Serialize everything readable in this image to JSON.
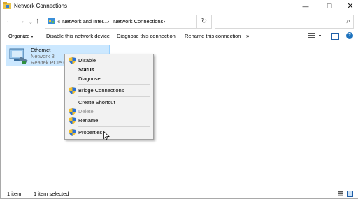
{
  "window": {
    "title": "Network Connections",
    "controls": {
      "minimize": "—",
      "maximize": "☐",
      "close": "✕"
    }
  },
  "navigation": {
    "back": "←",
    "forward": "→",
    "recent": "⌄",
    "up": "↑",
    "address_overflow": "«",
    "address_parts": [
      "Network and Inter...",
      "Network Connections"
    ],
    "address_separator": "›",
    "refresh": "↻",
    "search_placeholder": "",
    "search_icon": "⌕"
  },
  "toolbar": {
    "organize": "Organize",
    "organize_arrow": "▾",
    "disable": "Disable this network device",
    "diagnose": "Diagnose this connection",
    "rename": "Rename this connection",
    "more": "»",
    "view_arrow": "▾",
    "help": "?"
  },
  "content": {
    "items": [
      {
        "name": "Ethernet",
        "network": "Network 3",
        "adapter": "Realtek PCIe Gb",
        "selected": true
      }
    ]
  },
  "context_menu": {
    "items": [
      {
        "label": "Disable",
        "icon": "shield-icon",
        "bold": false,
        "disabled": false
      },
      {
        "label": "Status",
        "icon": "",
        "bold": true,
        "disabled": false
      },
      {
        "label": "Diagnose",
        "icon": "",
        "bold": false,
        "disabled": false
      },
      {
        "label": "Bridge Connections",
        "icon": "shield-icon",
        "bold": false,
        "disabled": false
      },
      {
        "label": "Create Shortcut",
        "icon": "",
        "bold": false,
        "disabled": false
      },
      {
        "label": "Delete",
        "icon": "shield-icon",
        "bold": false,
        "disabled": true
      },
      {
        "label": "Rename",
        "icon": "shield-icon",
        "bold": false,
        "disabled": false
      },
      {
        "label": "Properties",
        "icon": "shield-icon",
        "bold": false,
        "disabled": false
      }
    ]
  },
  "status_bar": {
    "item_count": "1 item",
    "selection": "1 item selected"
  },
  "colors": {
    "selection_fill": "#cce8ff",
    "selection_border": "#99d1ff",
    "menu_background": "#f2f2f2",
    "accent": "#1e73be"
  }
}
